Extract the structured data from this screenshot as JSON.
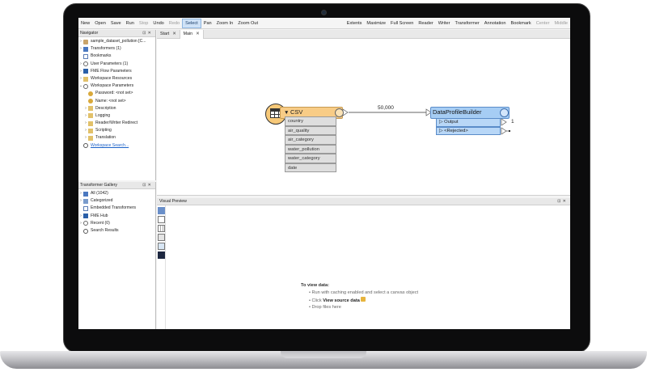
{
  "toolbar": {
    "items": [
      "New",
      "Open",
      "Save",
      "Run",
      "Stop",
      "Undo",
      "Redo",
      "Select",
      "Pan",
      "Zoom In",
      "Zoom Out"
    ],
    "right_items": [
      "Extents",
      "Maximize",
      "Full Screen",
      "Reader",
      "Writer",
      "Transformer",
      "Annotation",
      "Bookmark",
      "Center",
      "Middle"
    ]
  },
  "navigator": {
    "title": "Navigator",
    "items": [
      {
        "label": "sample_dataset_pollution [C..."
      },
      {
        "label": "Transformers (1)"
      },
      {
        "label": "Bookmarks"
      },
      {
        "label": "User Parameters (1)"
      },
      {
        "label": "FME Flow Parameters"
      },
      {
        "label": "Workspace Resources"
      },
      {
        "label": "Workspace Parameters"
      },
      {
        "label": "Password: <not set>"
      },
      {
        "label": "Name: <not set>"
      },
      {
        "label": "Description"
      },
      {
        "label": "Logging"
      },
      {
        "label": "Reader/Writer Redirect"
      },
      {
        "label": "Scripting"
      },
      {
        "label": "Translation"
      },
      {
        "label": "Workspace Search..."
      }
    ]
  },
  "gallery": {
    "title": "Transformer Gallery",
    "items": [
      {
        "label": "All (1042)"
      },
      {
        "label": "Categorized"
      },
      {
        "label": "Embedded Transformers"
      },
      {
        "label": "FME Hub"
      },
      {
        "label": "Recent (0)"
      },
      {
        "label": "Search Results"
      }
    ]
  },
  "tabs": [
    {
      "label": "Start",
      "close": "✕"
    },
    {
      "label": "Main",
      "close": "✕"
    }
  ],
  "canvas": {
    "csv": {
      "title": "CSV",
      "attributes": [
        "country",
        "air_quality",
        "air_category",
        "water_pollution",
        "water_category",
        "date"
      ]
    },
    "connection_count": "50,000",
    "dpb": {
      "title": "DataProfileBuilder",
      "ports": [
        "Output",
        "<Rejected>"
      ],
      "output_count": "1"
    }
  },
  "preview": {
    "title": "Visual Preview",
    "heading": "To view data:",
    "line1": "Run with caching enabled and select a canvas object",
    "line2_prefix": "Click ",
    "line2_bold": "View source data",
    "line3": "Drop files here"
  },
  "colors": {
    "reader": "#f8cc86",
    "transformer": "#a6cdf4",
    "link": "#1d63c9"
  }
}
